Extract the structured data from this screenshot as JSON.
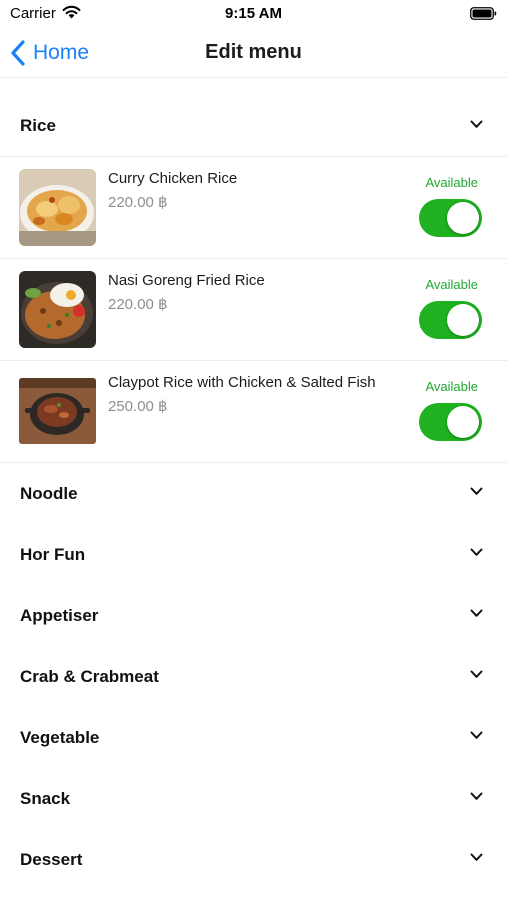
{
  "status_bar": {
    "carrier": "Carrier",
    "time": "9:15 AM",
    "wifi_icon": "wifi-icon",
    "battery_icon": "battery-icon"
  },
  "nav": {
    "back_label": "Home",
    "back_icon": "chevron-left-icon",
    "title": "Edit menu"
  },
  "colors": {
    "accent_blue": "#1a82f7",
    "toggle_on": "#1fb11f",
    "available_text": "#20a830",
    "price_gray": "#8e8e93"
  },
  "categories": [
    {
      "name": "Rice",
      "expanded": true,
      "items": [
        {
          "name": "Curry Chicken Rice",
          "price": "220.00 ฿",
          "status": "Available",
          "available": true,
          "image": "curry-chicken-rice-photo"
        },
        {
          "name": "Nasi Goreng Fried Rice",
          "price": "220.00 ฿",
          "status": "Available",
          "available": true,
          "image": "nasi-goreng-photo"
        },
        {
          "name": "Claypot Rice with Chicken & Salted Fish",
          "price": "250.00 ฿",
          "status": "Available",
          "available": true,
          "image": "claypot-rice-photo"
        }
      ]
    },
    {
      "name": "Noodle",
      "expanded": false
    },
    {
      "name": "Hor Fun",
      "expanded": false
    },
    {
      "name": "Appetiser",
      "expanded": false
    },
    {
      "name": "Crab & Crabmeat",
      "expanded": false
    },
    {
      "name": "Vegetable",
      "expanded": false
    },
    {
      "name": "Snack",
      "expanded": false
    },
    {
      "name": "Dessert",
      "expanded": false
    }
  ]
}
